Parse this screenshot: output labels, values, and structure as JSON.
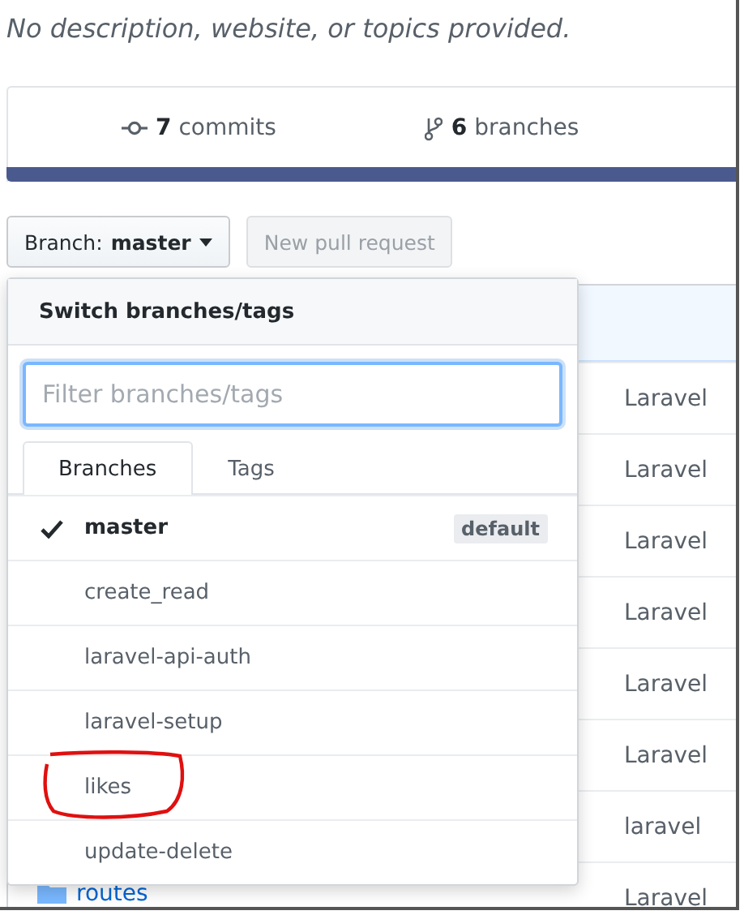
{
  "description": "No description, website, or topics provided.",
  "stats": [
    {
      "kind": "commits",
      "count": "7",
      "label": "commits"
    },
    {
      "kind": "branches",
      "count": "6",
      "label": "branches"
    }
  ],
  "branch_button": {
    "prefix": "Branch:",
    "branch": "master"
  },
  "new_pull_request": {
    "label": "New pull request",
    "disabled": true
  },
  "file_table": {
    "rows": [
      {
        "column_1": "",
        "column_2": "Laravel"
      },
      {
        "column_1": "",
        "column_2": "Laravel"
      },
      {
        "column_1": "",
        "column_2": "Laravel"
      },
      {
        "column_1": "",
        "column_2": "Laravel"
      },
      {
        "column_1": "",
        "column_2": "Laravel"
      },
      {
        "column_1": "",
        "column_2": "Laravel"
      },
      {
        "column_1": "",
        "column_2": "laravel"
      },
      {
        "column_1": "routes",
        "column_2": "Laravel"
      }
    ]
  },
  "dropdown": {
    "title": "Switch branches/tags",
    "filter": {
      "placeholder": "Filter branches/tags"
    },
    "tabs": [
      {
        "label": "Branches",
        "selected": true
      },
      {
        "label": "Tags",
        "selected": false
      }
    ],
    "items": [
      {
        "name": "master",
        "checked": true,
        "badge": "default",
        "circled": false
      },
      {
        "name": "create_read",
        "checked": false,
        "circled": false
      },
      {
        "name": "laravel-api-auth",
        "checked": false,
        "circled": false
      },
      {
        "name": "laravel-setup",
        "checked": false,
        "circled": false
      },
      {
        "name": "likes",
        "checked": false,
        "circled": true
      },
      {
        "name": "update-delete",
        "checked": false,
        "circled": false
      }
    ]
  }
}
